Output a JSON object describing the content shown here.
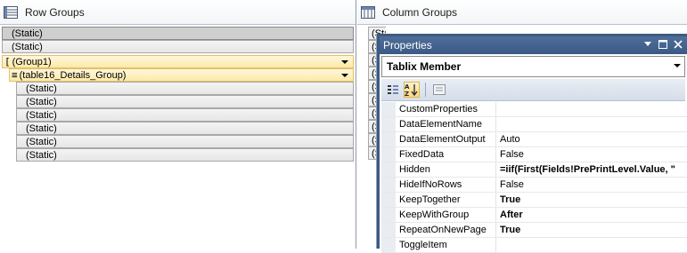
{
  "row_groups": {
    "title": "Row Groups",
    "items": [
      {
        "label": "(Static)"
      },
      {
        "label": "(Static)"
      },
      {
        "label": "(Group1)"
      },
      {
        "label": "(table16_Details_Group)"
      },
      {
        "label": "(Static)"
      },
      {
        "label": "(Static)"
      },
      {
        "label": "(Static)"
      },
      {
        "label": "(Static)"
      },
      {
        "label": "(Static)"
      },
      {
        "label": "(Static)"
      }
    ]
  },
  "column_groups": {
    "title": "Column Groups",
    "items": [
      "(Static)",
      "(S",
      "(S",
      "(S",
      "(S",
      "(S",
      "(S",
      "(S",
      "(S",
      "(S"
    ]
  },
  "properties": {
    "title": "Properties",
    "object": "Tablix Member",
    "rows": [
      {
        "name": "CustomProperties",
        "value": ""
      },
      {
        "name": "DataElementName",
        "value": ""
      },
      {
        "name": "DataElementOutput",
        "value": "Auto"
      },
      {
        "name": "FixedData",
        "value": "False"
      },
      {
        "name": "Hidden",
        "value": "=iif(First(Fields!PrePrintLevel.Value, \""
      },
      {
        "name": "HideIfNoRows",
        "value": "False"
      },
      {
        "name": "KeepTogether",
        "value": "True"
      },
      {
        "name": "KeepWithGroup",
        "value": "After"
      },
      {
        "name": "RepeatOnNewPage",
        "value": "True"
      },
      {
        "name": "ToggleItem",
        "value": ""
      }
    ]
  }
}
